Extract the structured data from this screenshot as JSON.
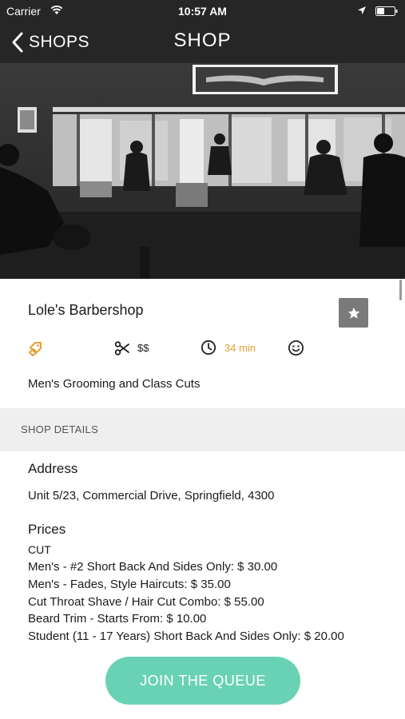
{
  "status_bar": {
    "carrier": "Carrier",
    "time": "10:57 AM",
    "icons": [
      "wifi-icon",
      "location-arrow-icon",
      "battery-icon"
    ]
  },
  "nav": {
    "back_label": "SHOPS",
    "title": "SHOP"
  },
  "shop": {
    "name": "Lole's Barbershop",
    "price_level": "$$",
    "wait_time": "34 min",
    "tagline": "Men's Grooming and Class Cuts",
    "icons": [
      "tag-icon",
      "scissors-icon",
      "clock-icon",
      "smiley-icon",
      "star-icon"
    ]
  },
  "details": {
    "section_title": "SHOP DETAILS",
    "address_heading": "Address",
    "address": "Unit 5/23, Commercial Drive, Springfield, 4300",
    "prices_heading": "Prices",
    "price_category": "CUT",
    "prices": [
      "Men's - #2 Short Back And Sides Only: $ 30.00",
      "Men's - Fades, Style Haircuts: $ 35.00",
      "Cut Throat Shave / Hair Cut Combo: $ 55.00",
      "Beard Trim - Starts From: $ 10.00",
      "Student (11 - 17 Years) Short Back And Sides Only: $ 20.00"
    ]
  },
  "actions": {
    "join_label": "JOIN THE QUEUE"
  },
  "colors": {
    "header_bg": "#262626",
    "accent_orange": "#e8a033",
    "join_button": "#6ad2b4",
    "favorite_button": "#7a7a7a",
    "section_bg": "#efefef"
  }
}
